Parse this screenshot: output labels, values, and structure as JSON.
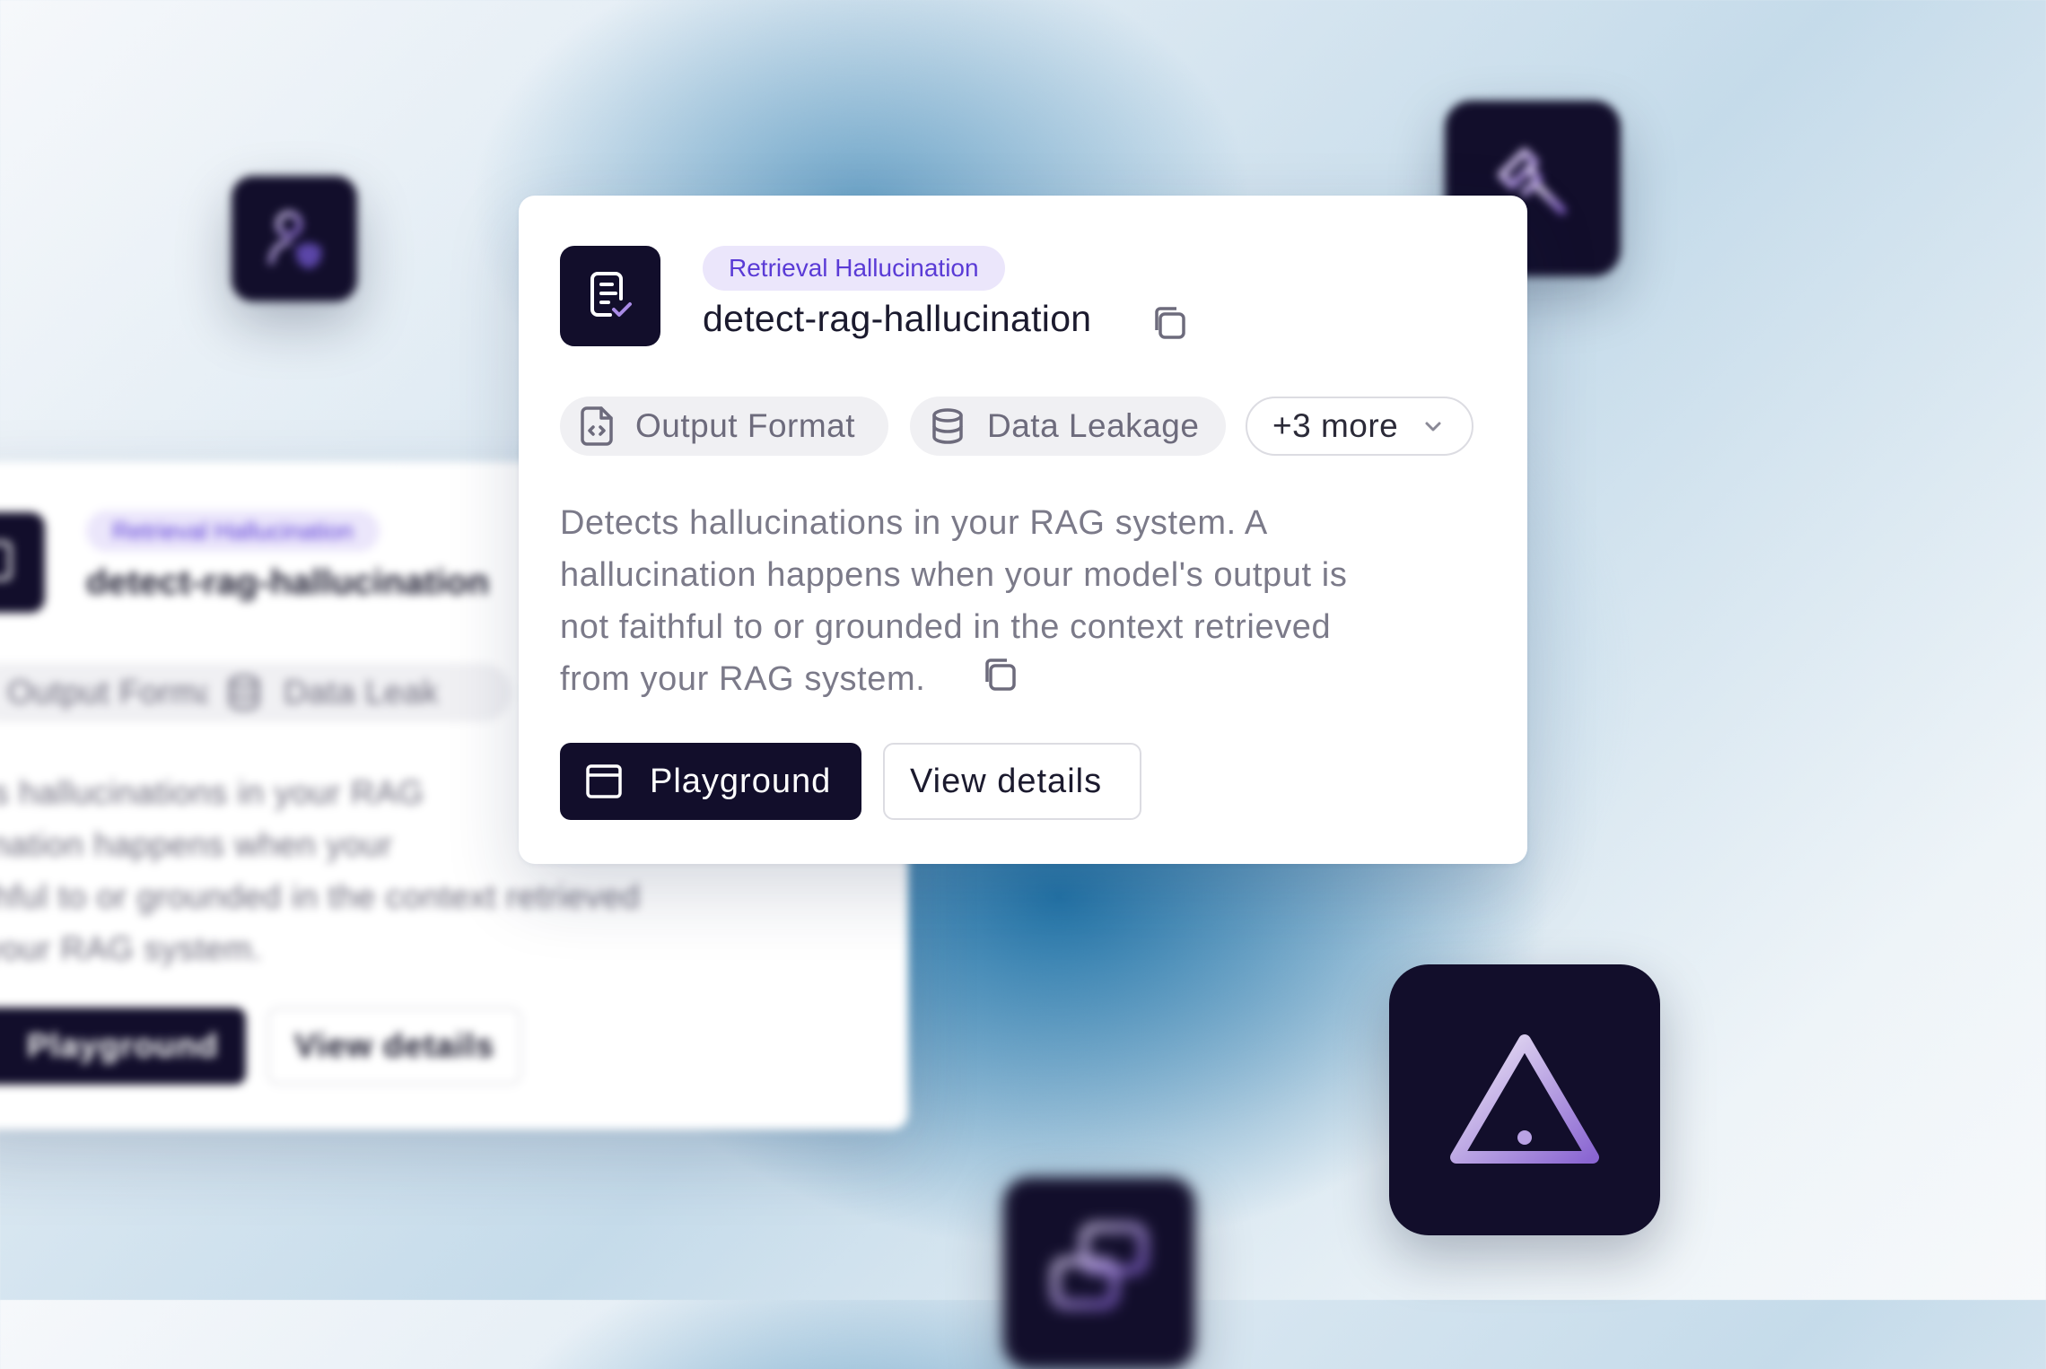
{
  "card": {
    "category": "Retrieval Hallucination",
    "name": "detect-rag-hallucination",
    "tags": [
      "Output Format",
      "Data Leakage"
    ],
    "more_label": "+3 more",
    "description_lines": [
      "Detects hallucinations in your RAG system. A",
      "hallucination happens when your model's output is",
      "not faithful to or grounded in the context retrieved",
      "from your RAG system."
    ],
    "primary_button": "Playground",
    "secondary_button": "View details"
  },
  "background_card": {
    "category": "Retrieval Hallucination",
    "name": "detect-rag-hallucination",
    "tags": [
      "Output Format",
      "Data Leak"
    ],
    "description_lines": [
      "ects hallucinations in your RAG",
      "ucination happens when your",
      " faithful to or grounded in the context retrieved",
      "m your RAG system."
    ],
    "primary_button": "Playground",
    "secondary_button": "View details"
  },
  "icons": {
    "card_icon": "document-check-icon",
    "copy": "copy-icon",
    "output_format": "file-code-icon",
    "data_leakage": "database-icon",
    "dropdown": "chevron-down-icon",
    "playground": "browser-window-icon",
    "floating": [
      "user-shield-icon",
      "gavel-icon",
      "warning-triangle-icon",
      "chat-bubbles-icon"
    ]
  },
  "colors": {
    "tile": "#120e2b",
    "badge_bg": "#ebe6fb",
    "badge_text": "#5a3bd6",
    "accent_gradient": [
      "#e9e2f3",
      "#8f6bd4"
    ]
  }
}
